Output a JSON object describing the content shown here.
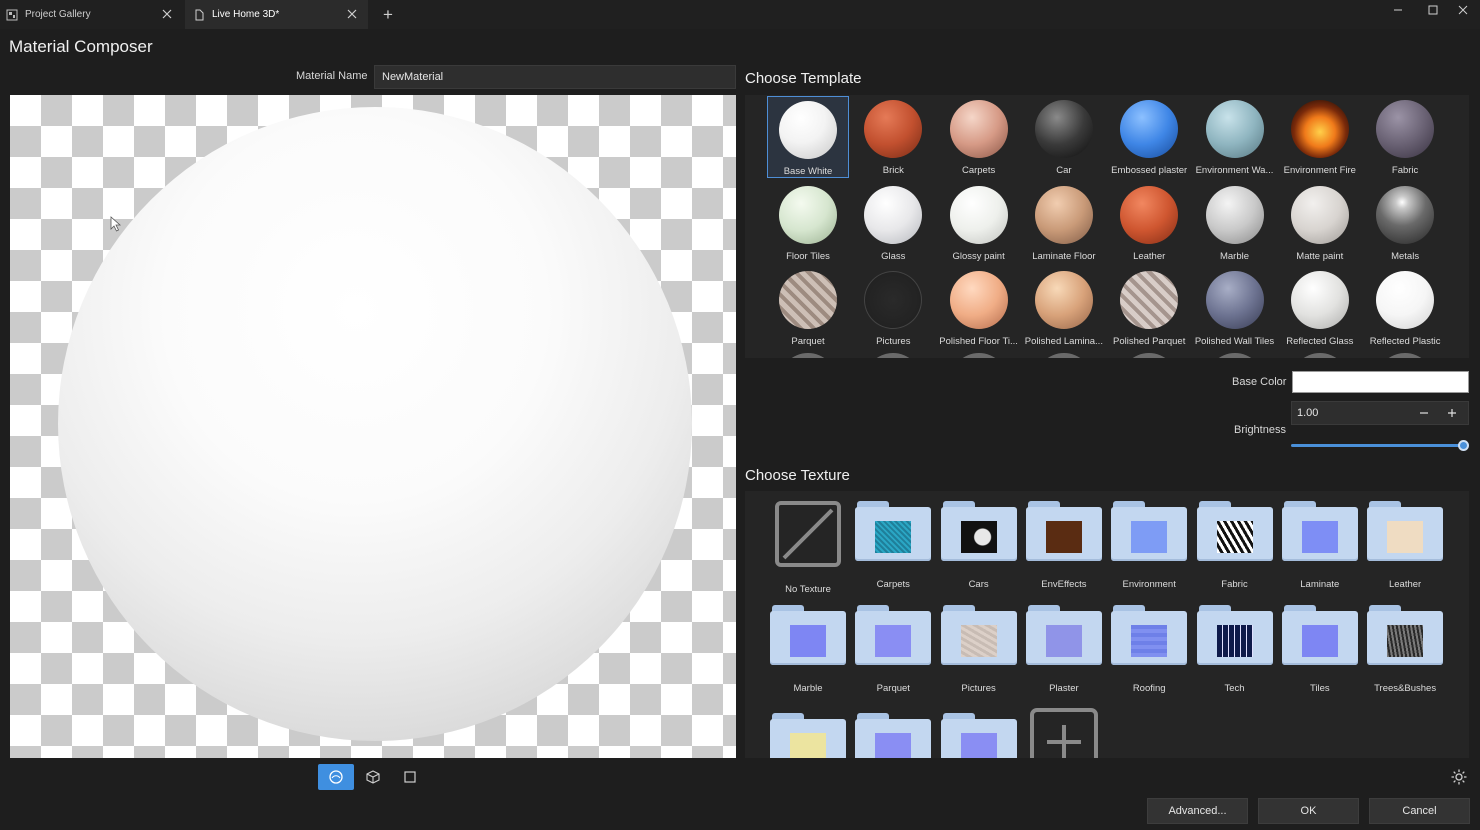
{
  "tabs": [
    {
      "label": "Project Gallery",
      "icon": "gallery-icon"
    },
    {
      "label": "Live Home 3D*",
      "icon": "document-icon"
    }
  ],
  "page_title": "Material Composer",
  "material_name": {
    "label": "Material Name",
    "value": "NewMaterial"
  },
  "choose_template": {
    "title": "Choose Template",
    "items": [
      {
        "label": "Base White"
      },
      {
        "label": "Brick"
      },
      {
        "label": "Carpets"
      },
      {
        "label": "Car"
      },
      {
        "label": "Embossed plaster"
      },
      {
        "label": "Environment Wa..."
      },
      {
        "label": "Environment Fire"
      },
      {
        "label": "Fabric"
      },
      {
        "label": "Floor Tiles"
      },
      {
        "label": "Glass"
      },
      {
        "label": "Glossy paint"
      },
      {
        "label": "Laminate Floor"
      },
      {
        "label": "Leather"
      },
      {
        "label": "Marble"
      },
      {
        "label": "Matte paint"
      },
      {
        "label": "Metals"
      },
      {
        "label": "Parquet"
      },
      {
        "label": "Pictures"
      },
      {
        "label": "Polished Floor Ti..."
      },
      {
        "label": "Polished Lamina..."
      },
      {
        "label": "Polished Parquet"
      },
      {
        "label": "Polished Wall Tiles"
      },
      {
        "label": "Reflected Glass"
      },
      {
        "label": "Reflected Plastic"
      }
    ]
  },
  "properties": {
    "base_color_label": "Base Color",
    "base_color": "#ffffff",
    "brightness_label": "Brightness",
    "brightness_value": "1.00",
    "brightness_fraction": 1.0
  },
  "choose_texture": {
    "title": "Choose Texture",
    "items": [
      {
        "label": "No Texture"
      },
      {
        "label": "Carpets"
      },
      {
        "label": "Cars"
      },
      {
        "label": "EnvEffects"
      },
      {
        "label": "Environment"
      },
      {
        "label": "Fabric"
      },
      {
        "label": "Laminate"
      },
      {
        "label": "Leather"
      },
      {
        "label": "Marble"
      },
      {
        "label": "Parquet"
      },
      {
        "label": "Pictures"
      },
      {
        "label": "Plaster"
      },
      {
        "label": "Roofing"
      },
      {
        "label": "Tech"
      },
      {
        "label": "Tiles"
      },
      {
        "label": "Trees&Bushes"
      }
    ]
  },
  "buttons": {
    "advanced": "Advanced...",
    "ok": "OK",
    "cancel": "Cancel"
  },
  "colors": {
    "accent": "#3f8fe0",
    "background": "#1e1e1e",
    "panel": "#252525"
  }
}
